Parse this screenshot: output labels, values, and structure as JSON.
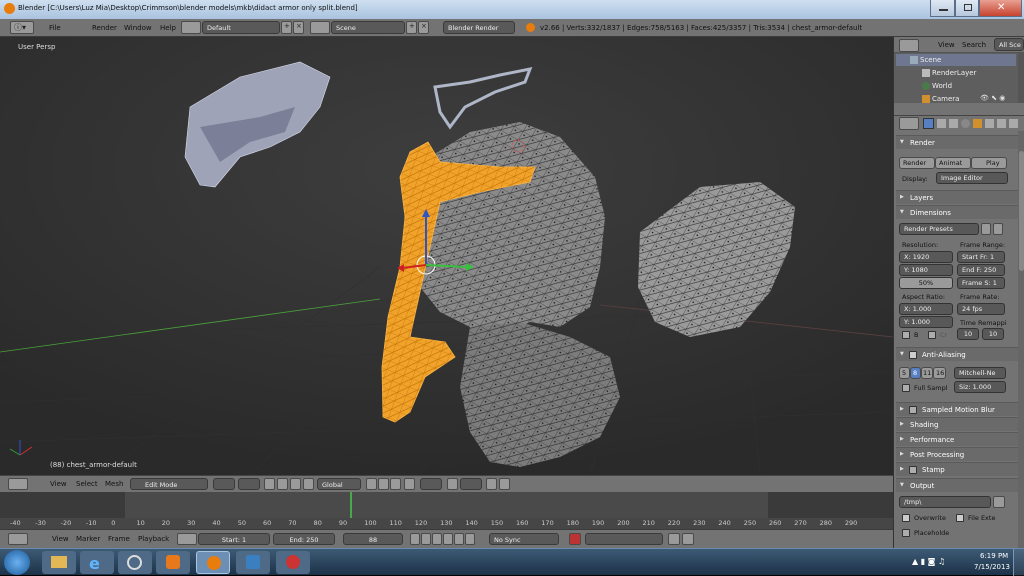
{
  "window": {
    "title": "Blender [C:\\Users\\Luz Mia\\Desktop\\Crimmson\\blender models\\mkb\\didact armor only split.blend]"
  },
  "info_header": {
    "menus": [
      "File",
      "Render",
      "Window",
      "Help"
    ],
    "screen_layout": "Default",
    "scene": "Scene",
    "render_engine": "Blender Render",
    "stats": "v2.66 | Verts:332/1837 | Edges:758/5163 | Faces:425/3357 | Tris:3534 | chest_armor-default"
  },
  "viewport": {
    "view_name": "User Persp",
    "object_info": "(88) chest_armor-default"
  },
  "outliner": {
    "menus": [
      "View",
      "Search"
    ],
    "filter": "All Sce",
    "items": [
      "Scene",
      "RenderLayer",
      "World",
      "Camera"
    ]
  },
  "properties": {
    "render": {
      "header": "Render",
      "render_btn": "Render",
      "animation_btn": "Animat",
      "play_btn": "Play",
      "display_label": "Display:",
      "display_value": "Image Editor"
    },
    "layers_header": "Layers",
    "dimensions": {
      "header": "Dimensions",
      "presets": "Render Presets",
      "resolution_label": "Resolution:",
      "res_x": "X: 1920",
      "res_y": "Y: 1080",
      "res_pct": "50%",
      "frame_range_label": "Frame Range:",
      "start_frame": "Start Fr: 1",
      "end_frame": "End F: 250",
      "frame_step": "Frame S: 1",
      "aspect_label": "Aspect Ratio:",
      "aspect_x": "X: 1.000",
      "aspect_y": "Y: 1.000",
      "frame_rate_label": "Frame Rate:",
      "frame_rate": "24 fps",
      "time_remap_label": "Time Remappi",
      "border_label": "B",
      "crop_label": "Cr",
      "remap_old": "10",
      "remap_new": "10"
    },
    "anti_aliasing": {
      "header": "Anti-Aliasing",
      "samples": [
        "5",
        "8",
        "11",
        "16"
      ],
      "selected_sample": "8",
      "filter": "Mitchell-Ne",
      "full_sample": "Full Sampl",
      "size": "Siz: 1.000"
    },
    "collapsed_panels": [
      "Sampled Motion Blur",
      "Shading",
      "Performance",
      "Post Processing",
      "Stamp"
    ],
    "output": {
      "header": "Output",
      "path": "/tmp\\",
      "overwrite": "Overwrite",
      "file_extensions": "File Exte",
      "placeholders": "Placeholde"
    }
  },
  "view3d_header": {
    "menus": [
      "View",
      "Select",
      "Mesh"
    ],
    "mode": "Edit Mode",
    "orientation": "Global"
  },
  "timeline": {
    "ticks": [
      "-40",
      "-30",
      "-20",
      "-10",
      "0",
      "10",
      "20",
      "30",
      "40",
      "50",
      "60",
      "70",
      "80",
      "90",
      "100",
      "110",
      "120",
      "130",
      "140",
      "150",
      "160",
      "170",
      "180",
      "190",
      "200",
      "210",
      "220",
      "230",
      "240",
      "250",
      "260",
      "270",
      "280",
      "290"
    ],
    "current_frame": 88,
    "menus": [
      "View",
      "Marker",
      "Frame",
      "Playback"
    ],
    "start": "Start: 1",
    "end": "End: 250",
    "frame": "88",
    "sync": "No Sync"
  },
  "taskbar": {
    "time": "6:19 PM",
    "date": "7/15/2013"
  },
  "colors": {
    "viewport_bg": "#393939",
    "selection": "#f5a623",
    "panel_bg": "#737373",
    "accent_blue": "#5680c2"
  }
}
